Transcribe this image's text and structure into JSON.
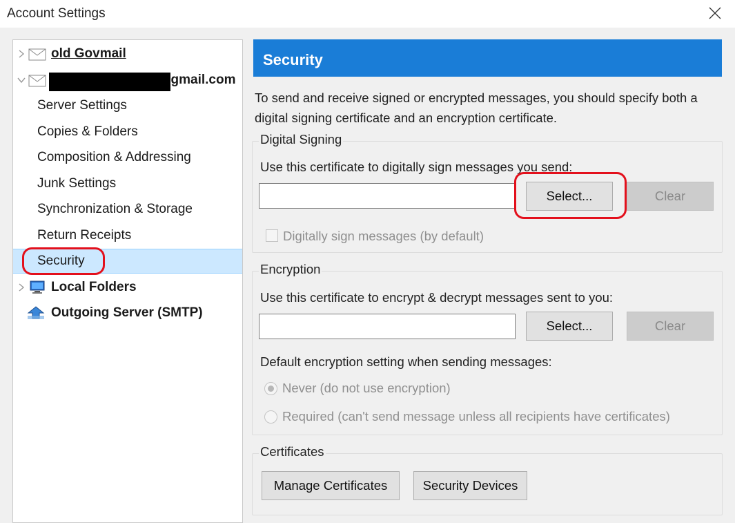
{
  "window": {
    "title": "Account Settings"
  },
  "tree": {
    "accounts": [
      {
        "name": "old Govmail",
        "expanded": false
      },
      {
        "name_suffix": "@gmail.com",
        "expanded": true,
        "children": [
          "Server Settings",
          "Copies & Folders",
          "Composition & Addressing",
          "Junk Settings",
          "Synchronization & Storage",
          "Return Receipts",
          "Security"
        ],
        "selected_child": "Security"
      },
      {
        "name": "Local Folders",
        "expanded": false
      },
      {
        "name": "Outgoing Server (SMTP)"
      }
    ]
  },
  "panel": {
    "header": "Security",
    "description": "To send and receive signed or encrypted messages, you should specify both a digital signing certificate and an encryption certificate.",
    "header_color": "#1a7dd7",
    "digital_signing": {
      "legend": "Digital Signing",
      "label": "Use this certificate to digitally sign messages you send:",
      "cert_value": "",
      "select_button": "Select...",
      "clear_button": "Clear",
      "checkbox_label": "Digitally sign messages (by default)",
      "checkbox_checked": false
    },
    "encryption": {
      "legend": "Encryption",
      "label": "Use this certificate to encrypt & decrypt messages sent to you:",
      "cert_value": "",
      "select_button": "Select...",
      "clear_button": "Clear",
      "default_label": "Default encryption setting when sending messages:",
      "option_never": "Never (do not use encryption)",
      "option_required": "Required (can't send message unless all recipients have certificates)",
      "selected_option": "never"
    },
    "certificates": {
      "legend": "Certificates",
      "manage_button": "Manage Certificates",
      "devices_button": "Security Devices"
    }
  },
  "annotation_color": "#e3101c"
}
